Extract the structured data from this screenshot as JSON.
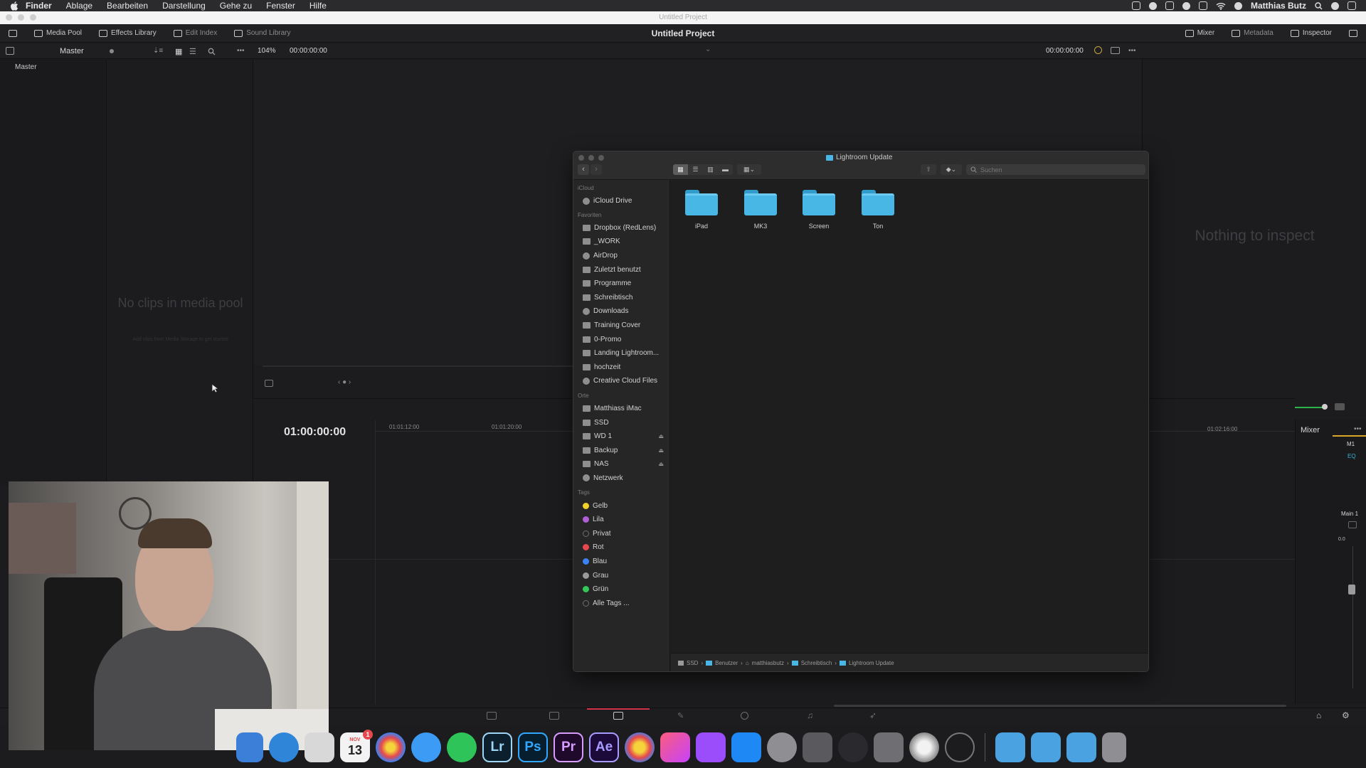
{
  "menubar": {
    "app": "Finder",
    "items": [
      "Ablage",
      "Bearbeiten",
      "Darstellung",
      "Gehe zu",
      "Fenster",
      "Hilfe"
    ],
    "user": "Matthias Butz"
  },
  "window": {
    "title": "Untitled Project"
  },
  "topbar": {
    "media_pool": "Media Pool",
    "effects_library": "Effects Library",
    "edit_index": "Edit Index",
    "sound_library": "Sound Library",
    "project_title": "Untitled Project",
    "mixer": "Mixer",
    "metadata": "Metadata",
    "inspector": "Inspector"
  },
  "toolbar2": {
    "bin": "Master",
    "zoom": "104%",
    "source_tc": "00:00:00:00",
    "record_tc": "00:00:00:00"
  },
  "bins": {
    "master": "Master"
  },
  "media_pool": {
    "empty": "No clips in media pool",
    "hint": "Add clips from Media Storage to get started"
  },
  "inspector": {
    "empty": "Nothing to inspect"
  },
  "timeline": {
    "timecode": "01:00:00:00",
    "ruler": [
      "01:01:12:00",
      "01:01:20:00",
      "01:02:16:00"
    ]
  },
  "mixer": {
    "title": "Mixer",
    "channel": "M1",
    "eq": "EQ",
    "main": "Main 1",
    "level": "0.0"
  },
  "finder": {
    "title": "Lightroom Update",
    "search_placeholder": "Suchen",
    "sections": {
      "icloud": "iCloud",
      "favorites": "Favoriten",
      "places": "Orte",
      "tags": "Tags"
    },
    "icloud_items": [
      "iCloud Drive"
    ],
    "favorites": [
      "Dropbox (RedLens)",
      "_WORK",
      "AirDrop",
      "Zuletzt benutzt",
      "Programme",
      "Schreibtisch",
      "Downloads",
      "Training Cover",
      "0-Promo",
      "Landing Lightroom...",
      "hochzeit",
      "Creative Cloud Files"
    ],
    "places": [
      "Matthiass iMac",
      "SSD",
      "WD 1",
      "Backup",
      "NAS",
      "Netzwerk"
    ],
    "tags": [
      {
        "name": "Gelb",
        "color": "#f2d02b"
      },
      {
        "name": "Lila",
        "color": "#b05fd6"
      },
      {
        "name": "Privat",
        "color": "#262626"
      },
      {
        "name": "Rot",
        "color": "#e5484d"
      },
      {
        "name": "Blau",
        "color": "#3b82f6"
      },
      {
        "name": "Grau",
        "color": "#9a9a9a"
      },
      {
        "name": "Grün",
        "color": "#34c759"
      },
      {
        "name": "Alle Tags ...",
        "color": "#262626"
      }
    ],
    "folders": [
      "iPad",
      "MK3",
      "Screen",
      "Ton"
    ],
    "path": [
      "SSD",
      "Benutzer",
      "matthiasbutz",
      "Schreibtisch",
      "Lightroom Update"
    ]
  },
  "dock": {
    "calendar_month": "NOV",
    "calendar_day": "13",
    "calendar_badge": "1",
    "lightroom": "Lr",
    "photoshop": "Ps",
    "premiere": "Pr",
    "after_effects": "Ae"
  }
}
